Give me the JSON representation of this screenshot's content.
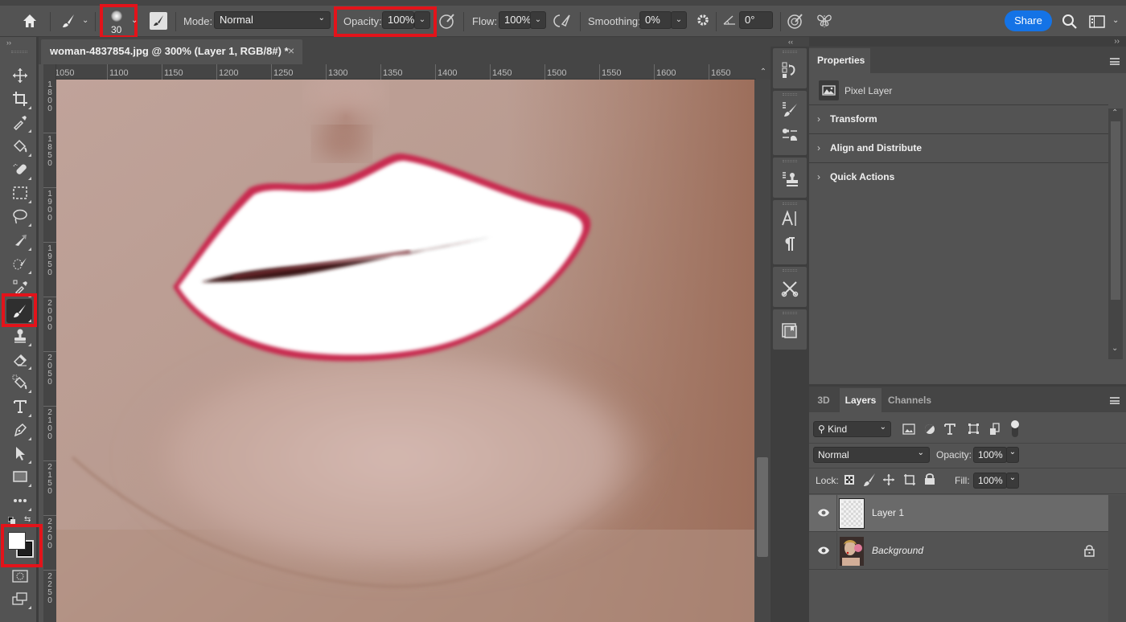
{
  "options_bar": {
    "brush_size": "30",
    "mode_label": "Mode:",
    "mode_value": "Normal",
    "opacity_label": "Opacity:",
    "opacity_value": "100%",
    "flow_label": "Flow:",
    "flow_value": "100%",
    "smoothing_label": "Smoothing:",
    "smoothing_value": "0%",
    "angle_value": "0°",
    "share_label": "Share",
    "share_color": "#1473e6",
    "highlight_color": "#e3131a"
  },
  "document": {
    "tab_title": "woman-4837854.jpg @ 300% (Layer 1, RGB/8#) *",
    "close_glyph": "×"
  },
  "rulers": {
    "horizontal": [
      "1050",
      "1100",
      "1150",
      "1200",
      "1250",
      "1300",
      "1350",
      "1400",
      "1450",
      "1500",
      "1550",
      "1600",
      "1650"
    ],
    "vertical": [
      "1800",
      "1850",
      "1900",
      "1950",
      "2000",
      "2050",
      "2100",
      "2150",
      "2200",
      "2250"
    ]
  },
  "toolbar": {
    "tools": [
      "move",
      "crop",
      "eyedropper",
      "paint-bucket",
      "spot-healing",
      "marquee",
      "lasso",
      "brush-triangle",
      "quick-selection",
      "color-sampler",
      "brush",
      "clone-stamp",
      "eraser",
      "gradient",
      "type",
      "pen",
      "path-selection",
      "rectangle",
      "more",
      "default-colors",
      "swap-colors",
      "color-swatches",
      "quick-mask",
      "screen-mode"
    ],
    "active_tool": "brush",
    "foreground_color": "#ffffff",
    "background_color": "#1e1e1e"
  },
  "properties": {
    "tab": "Properties",
    "layer_type": "Pixel Layer",
    "sections": [
      "Transform",
      "Align and Distribute",
      "Quick Actions"
    ]
  },
  "layers_panel": {
    "tabs": [
      "3D",
      "Layers",
      "Channels"
    ],
    "active_tab": "Layers",
    "filter_value": "Kind",
    "blend_mode": "Normal",
    "opacity_label": "Opacity:",
    "opacity_value": "100%",
    "lock_label": "Lock:",
    "fill_label": "Fill:",
    "fill_value": "100%",
    "layers": [
      {
        "name": "Layer 1",
        "visible": true,
        "selected": true,
        "locked": false
      },
      {
        "name": "Background",
        "visible": true,
        "selected": false,
        "locked": true
      }
    ]
  },
  "canvas": {
    "skin_color": "#b58d7f",
    "lip_outline_color": "#c8294f",
    "lip_fill_color": "#ffffff"
  }
}
